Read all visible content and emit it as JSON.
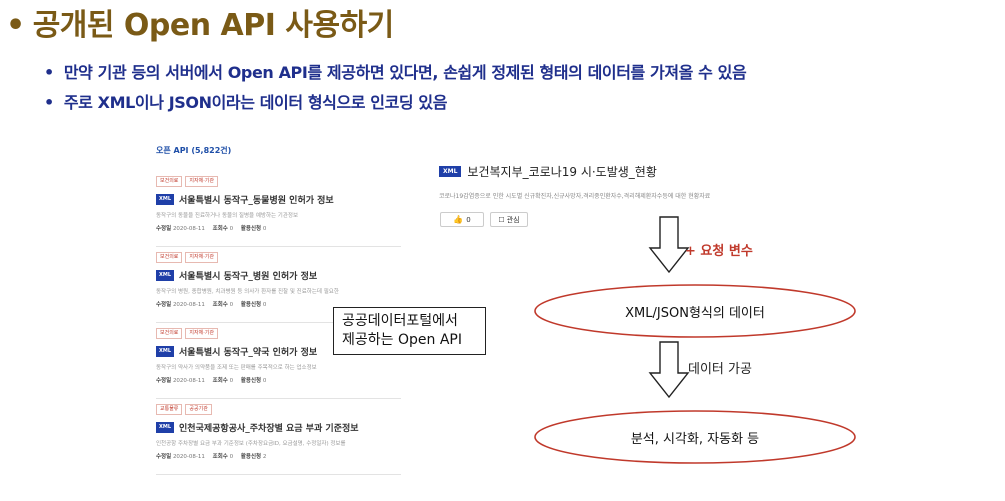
{
  "slide": {
    "title": "공개된 Open API 사용하기",
    "bullets": [
      "만약 기관 등의 서버에서 Open API를 제공하면 있다면, 손쉽게 정제된 형태의 데이터를 가져올 수 있음",
      "주로 XML이나 JSON이라는 데이터 형식으로 인코딩 있음"
    ]
  },
  "api_list": {
    "header": "오픈 API (5,822건)",
    "badge": "XML",
    "meta_labels": {
      "modified": "수정일",
      "views": "조회수",
      "usage": "활용신청"
    },
    "items": [
      {
        "tags": [
          "보건의료",
          "지자체·기관"
        ],
        "title": "서울특별시 동작구_동물병원 인허가 정보",
        "desc": "동작구의 동물을 진료하거나 동물의 질병을 예방하는 기관정보",
        "date": "2020-08-11",
        "views": "0",
        "usage": "0"
      },
      {
        "tags": [
          "보건의료",
          "지자체·기관"
        ],
        "title": "서울특별시 동작구_병원 인허가 정보",
        "desc": "동작구의 병원, 종합병원, 치과병원 등 의사가 환자를 진찰 및 진료하는데 필요한",
        "date": "2020-08-11",
        "views": "0",
        "usage": "0"
      },
      {
        "tags": [
          "보건의료",
          "지자체·기관"
        ],
        "title": "서울특별시 동작구_약국 인허가 정보",
        "desc": "동작구의 약사가 의약품을 조제 또는 판매를 주목적으로 하는 업소정보",
        "date": "2020-08-11",
        "views": "0",
        "usage": "0"
      },
      {
        "tags": [
          "교통물류",
          "공공기관"
        ],
        "title": "인천국제공항공사_주차장별 요금 부과 기준정보",
        "desc": "인천공항 주차장별 요금 부과 기준정보 (주차장요금ID, 요금설명, 수정일자) 정보를",
        "date": "2020-08-11",
        "views": "0",
        "usage": "2"
      }
    ]
  },
  "callout": [
    "공공데이터포털에서",
    "제공하는 Open API"
  ],
  "api_detail": {
    "badge": "XML",
    "title": "보건복지부_코로나19 시·도발생_현황",
    "desc": "코로나19감염증으로 인한 시도별 신규확진자,신규사망자,격리중인환자수,격리해제환자수등에 대한 현황자료",
    "like_count": "0",
    "fav_label": "관심"
  },
  "flow": {
    "step1_label": "+ 요청 변수",
    "node1": "XML/JSON형식의 데이터",
    "step2_label": "데이터 가공",
    "node2": "분석, 시각화, 자동화 등",
    "colors": {
      "ellipse_stroke": "#c0392b",
      "accent_text": "#c0392b"
    }
  }
}
